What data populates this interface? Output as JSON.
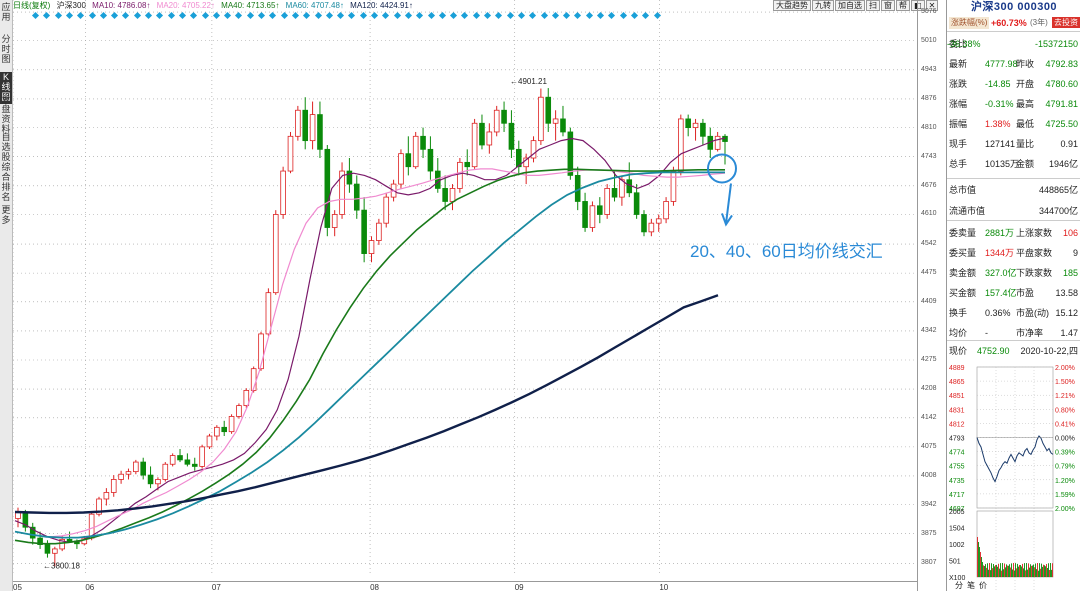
{
  "left_tabs": [
    "应用",
    "分时图",
    "K线图",
    "大盘资料",
    "自选股",
    "综合排名",
    "更多"
  ],
  "top_bar": {
    "prefix": "日线(复权)",
    "index": "沪深300",
    "ma10": "MA10: 4786.08↑",
    "ma20": "MA20: 4705.22↑",
    "ma40": "MA40: 4713.65↑",
    "ma60": "MA60: 4707.48↑",
    "ma120": "MA120: 4424.91↑"
  },
  "toolbar": [
    "大盘趋势",
    "九转",
    "加自选",
    "扫",
    "窗",
    "帮",
    "◧",
    "✕"
  ],
  "y_ticks": [
    "5076",
    "5010",
    "4943",
    "4876",
    "4810",
    "4743",
    "4676",
    "4610",
    "4542",
    "4475",
    "4409",
    "4342",
    "4275",
    "4208",
    "4142",
    "4075",
    "4008",
    "3942",
    "3875",
    "3807"
  ],
  "x_ticks": [
    "05",
    "06",
    "07",
    "08",
    "09",
    "10"
  ],
  "annotations": {
    "high": "4901.21",
    "low": "3800.18",
    "text": "20、40、60日均价线交汇"
  },
  "panel": {
    "title": "沪深300 000300",
    "sub_label": "涨跌幅(%)",
    "sub_value": "+60.73%",
    "sub_period": "(3年)",
    "sub_button": "去投资",
    "rows": [
      {
        "l1": "委比",
        "v1": "-36.38%",
        "v2": "-15372150"
      },
      {
        "l1": "最新",
        "v1": "4777.98",
        "l2": "昨收",
        "v2": "4792.83"
      },
      {
        "l1": "涨跌",
        "v1": "-14.85",
        "l2": "开盘",
        "v2": "4780.60"
      },
      {
        "l1": "涨幅",
        "v1": "-0.31%",
        "l2": "最高",
        "v2": "4791.81"
      },
      {
        "l1": "振幅",
        "v1": "1.38%",
        "l2": "最低",
        "v2": "4725.50"
      },
      {
        "l1": "现手",
        "v1": "127141",
        "l2": "量比",
        "v2": "0.91"
      },
      {
        "l1": "总手",
        "v1": "10135万",
        "l2": "金额",
        "v2": "1946亿"
      },
      {
        "l1": "总市值",
        "v2": "448865亿"
      },
      {
        "l1": "流通市值",
        "v2": "344700亿"
      },
      {
        "l1": "委卖量",
        "v1": "2881万",
        "l2": "上涨家数",
        "v2": "106"
      },
      {
        "l1": "委买量",
        "v1": "1344万",
        "l2": "平盘家数",
        "v2": "9"
      },
      {
        "l1": "卖金额",
        "v1": "327.0亿",
        "l2": "下跌家数",
        "v2": "185"
      },
      {
        "l1": "买金额",
        "v1": "157.4亿",
        "l2": "市盈",
        "v2": "13.58"
      },
      {
        "l1": "换手",
        "v1": "0.36%",
        "l2": "市盈(动)",
        "v2": "15.12"
      },
      {
        "l1": "均价",
        "v1": "-",
        "l2": "市净率",
        "v2": "1.47"
      }
    ],
    "now_label": "现价",
    "now_value": "4752.90",
    "now_date": "2020-10-22,四",
    "mini_left": [
      "4889",
      "4865",
      "4851",
      "4831",
      "4812",
      "4793",
      "4774",
      "4755",
      "4735",
      "4717",
      "4697"
    ],
    "mini_right": [
      "2.00%",
      "1.50%",
      "1.21%",
      "0.80%",
      "0.41%",
      "0.00%",
      "0.39%",
      "0.79%",
      "1.20%",
      "1.59%",
      "2.00%"
    ],
    "vol_ticks": [
      "2005",
      "1504",
      "1002",
      "501",
      "X100"
    ],
    "bottom_tabs": [
      "分",
      "笔",
      "价"
    ]
  },
  "chart_data": {
    "type": "candlestick",
    "title": "沪深300",
    "period": "daily",
    "ylim": [
      3780,
      5090
    ],
    "x_months": [
      "05",
      "06",
      "07",
      "08",
      "09",
      "10"
    ],
    "candles": [
      [
        3910,
        3935,
        3890,
        3925
      ],
      [
        3925,
        3930,
        3880,
        3890
      ],
      [
        3890,
        3900,
        3850,
        3865
      ],
      [
        3865,
        3880,
        3840,
        3850
      ],
      [
        3850,
        3860,
        3820,
        3830
      ],
      [
        3830,
        3845,
        3800,
        3840
      ],
      [
        3840,
        3870,
        3835,
        3862
      ],
      [
        3862,
        3880,
        3855,
        3858
      ],
      [
        3858,
        3862,
        3840,
        3852
      ],
      [
        3852,
        3870,
        3848,
        3865
      ],
      [
        3865,
        3925,
        3860,
        3920
      ],
      [
        3920,
        3960,
        3915,
        3955
      ],
      [
        3955,
        3980,
        3940,
        3970
      ],
      [
        3970,
        4010,
        3960,
        4000
      ],
      [
        4000,
        4020,
        3990,
        4012
      ],
      [
        4012,
        4025,
        4000,
        4018
      ],
      [
        4018,
        4045,
        4012,
        4040
      ],
      [
        4040,
        4050,
        4000,
        4010
      ],
      [
        4010,
        4030,
        3980,
        3990
      ],
      [
        3990,
        4005,
        3975,
        4000
      ],
      [
        4000,
        4040,
        3995,
        4035
      ],
      [
        4035,
        4060,
        4030,
        4055
      ],
      [
        4055,
        4070,
        4040,
        4045
      ],
      [
        4045,
        4060,
        4030,
        4035
      ],
      [
        4035,
        4050,
        4020,
        4030
      ],
      [
        4030,
        4080,
        4025,
        4075
      ],
      [
        4075,
        4105,
        4070,
        4100
      ],
      [
        4100,
        4125,
        4090,
        4120
      ],
      [
        4120,
        4135,
        4100,
        4110
      ],
      [
        4110,
        4150,
        4105,
        4145
      ],
      [
        4145,
        4175,
        4140,
        4170
      ],
      [
        4170,
        4210,
        4165,
        4205
      ],
      [
        4205,
        4260,
        4200,
        4255
      ],
      [
        4255,
        4340,
        4250,
        4335
      ],
      [
        4335,
        4440,
        4330,
        4430
      ],
      [
        4430,
        4620,
        4425,
        4610
      ],
      [
        4610,
        4720,
        4600,
        4710
      ],
      [
        4710,
        4800,
        4705,
        4790
      ],
      [
        4790,
        4860,
        4780,
        4850
      ],
      [
        4850,
        4880,
        4760,
        4780
      ],
      [
        4780,
        4870,
        4760,
        4840
      ],
      [
        4840,
        4870,
        4740,
        4760
      ],
      [
        4760,
        4770,
        4560,
        4580
      ],
      [
        4580,
        4620,
        4560,
        4610
      ],
      [
        4610,
        4730,
        4600,
        4710
      ],
      [
        4710,
        4740,
        4660,
        4680
      ],
      [
        4680,
        4700,
        4600,
        4620
      ],
      [
        4620,
        4650,
        4500,
        4520
      ],
      [
        4520,
        4560,
        4500,
        4550
      ],
      [
        4550,
        4600,
        4540,
        4590
      ],
      [
        4590,
        4660,
        4580,
        4650
      ],
      [
        4650,
        4690,
        4640,
        4680
      ],
      [
        4680,
        4760,
        4670,
        4750
      ],
      [
        4750,
        4790,
        4700,
        4720
      ],
      [
        4720,
        4800,
        4715,
        4790
      ],
      [
        4790,
        4810,
        4740,
        4760
      ],
      [
        4760,
        4790,
        4690,
        4710
      ],
      [
        4710,
        4740,
        4660,
        4670
      ],
      [
        4670,
        4700,
        4620,
        4640
      ],
      [
        4640,
        4680,
        4620,
        4670
      ],
      [
        4670,
        4740,
        4660,
        4730
      ],
      [
        4730,
        4760,
        4700,
        4720
      ],
      [
        4720,
        4830,
        4715,
        4820
      ],
      [
        4820,
        4840,
        4760,
        4770
      ],
      [
        4770,
        4820,
        4750,
        4800
      ],
      [
        4800,
        4860,
        4790,
        4850
      ],
      [
        4850,
        4870,
        4800,
        4820
      ],
      [
        4820,
        4850,
        4740,
        4760
      ],
      [
        4760,
        4780,
        4700,
        4720
      ],
      [
        4720,
        4750,
        4680,
        4740
      ],
      [
        4740,
        4790,
        4730,
        4780
      ],
      [
        4780,
        4900,
        4770,
        4880
      ],
      [
        4880,
        4901,
        4800,
        4820
      ],
      [
        4820,
        4850,
        4780,
        4830
      ],
      [
        4830,
        4860,
        4790,
        4800
      ],
      [
        4800,
        4810,
        4690,
        4700
      ],
      [
        4700,
        4720,
        4620,
        4640
      ],
      [
        4640,
        4660,
        4570,
        4580
      ],
      [
        4580,
        4640,
        4570,
        4630
      ],
      [
        4630,
        4650,
        4590,
        4610
      ],
      [
        4610,
        4680,
        4600,
        4670
      ],
      [
        4670,
        4710,
        4640,
        4650
      ],
      [
        4650,
        4700,
        4630,
        4690
      ],
      [
        4690,
        4730,
        4650,
        4660
      ],
      [
        4660,
        4680,
        4600,
        4610
      ],
      [
        4610,
        4620,
        4560,
        4570
      ],
      [
        4570,
        4600,
        4560,
        4590
      ],
      [
        4590,
        4610,
        4570,
        4600
      ],
      [
        4600,
        4650,
        4590,
        4640
      ],
      [
        4640,
        4720,
        4630,
        4710
      ],
      [
        4710,
        4840,
        4700,
        4830
      ],
      [
        4830,
        4840,
        4790,
        4810
      ],
      [
        4810,
        4830,
        4780,
        4820
      ],
      [
        4820,
        4830,
        4770,
        4790
      ],
      [
        4790,
        4810,
        4740,
        4760
      ],
      [
        4760,
        4800,
        4755,
        4790
      ],
      [
        4790,
        4795,
        4725,
        4778
      ]
    ],
    "ma_lines": {
      "MA10": [
        3905,
        3895,
        3880,
        3868,
        3860,
        3855,
        3858,
        3870,
        3885,
        3905,
        3925,
        3945,
        3960,
        3978,
        3995,
        4005,
        4015,
        4022,
        4028,
        4035,
        4045,
        4060,
        4085,
        4115,
        4160,
        4230,
        4330,
        4460,
        4580,
        4670,
        4700,
        4705,
        4700,
        4690,
        4675,
        4660,
        4655,
        4660,
        4670,
        4690,
        4700,
        4705,
        4700,
        4690,
        4690,
        4700,
        4720,
        4740,
        4760,
        4770,
        4780,
        4785,
        4780,
        4760,
        4735,
        4700,
        4680,
        4670,
        4680,
        4700,
        4730,
        4750,
        4760,
        4770,
        4780,
        4786
      ],
      "MA20": [
        3880,
        3875,
        3870,
        3868,
        3870,
        3875,
        3882,
        3892,
        3905,
        3918,
        3930,
        3945,
        3958,
        3970,
        3985,
        4000,
        4018,
        4040,
        4070,
        4110,
        4170,
        4250,
        4350,
        4450,
        4530,
        4590,
        4625,
        4640,
        4645,
        4645,
        4648,
        4652,
        4660,
        4668,
        4675,
        4682,
        4690,
        4698,
        4705,
        4712,
        4715,
        4715,
        4710,
        4705,
        4700,
        4700,
        4703,
        4706,
        4710,
        4712,
        4713,
        4712,
        4708,
        4705,
        4700,
        4698,
        4696,
        4696,
        4698,
        4700,
        4703,
        4705
      ],
      "MA40": [
        3860,
        3855,
        3852,
        3852,
        3855,
        3860,
        3868,
        3877,
        3888,
        3900,
        3912,
        3925,
        3940,
        3956,
        3973,
        3992,
        4012,
        4035,
        4062,
        4095,
        4135,
        4180,
        4230,
        4290,
        4345,
        4395,
        4440,
        4480,
        4515,
        4545,
        4575,
        4600,
        4625,
        4645,
        4660,
        4675,
        4688,
        4698,
        4706,
        4710,
        4712,
        4714,
        4714,
        4713,
        4712,
        4711,
        4710,
        4710,
        4710,
        4711,
        4712,
        4713,
        4713,
        4713
      ],
      "MA60": [
        3880,
        3873,
        3868,
        3866,
        3866,
        3870,
        3876,
        3885,
        3896,
        3908,
        3922,
        3938,
        3955,
        3973,
        3994,
        4016,
        4040,
        4067,
        4097,
        4130,
        4165,
        4200,
        4235,
        4270,
        4305,
        4340,
        4375,
        4410,
        4445,
        4480,
        4512,
        4545,
        4575,
        4605,
        4632,
        4655,
        4672,
        4686,
        4695,
        4702,
        4705,
        4707,
        4707,
        4707,
        4707,
        4707
      ],
      "MA120": [
        3925,
        3924,
        3923,
        3923,
        3924,
        3926,
        3929,
        3933,
        3938,
        3944,
        3950,
        3957,
        3965,
        3973,
        3982,
        3992,
        4002,
        4012,
        4022,
        4032,
        4043,
        4055,
        4068,
        4082,
        4096,
        4111,
        4127,
        4143,
        4160,
        4178,
        4197,
        4217,
        4238,
        4259,
        4281,
        4304,
        4327,
        4350,
        4373,
        4396,
        4410,
        4424
      ]
    }
  }
}
